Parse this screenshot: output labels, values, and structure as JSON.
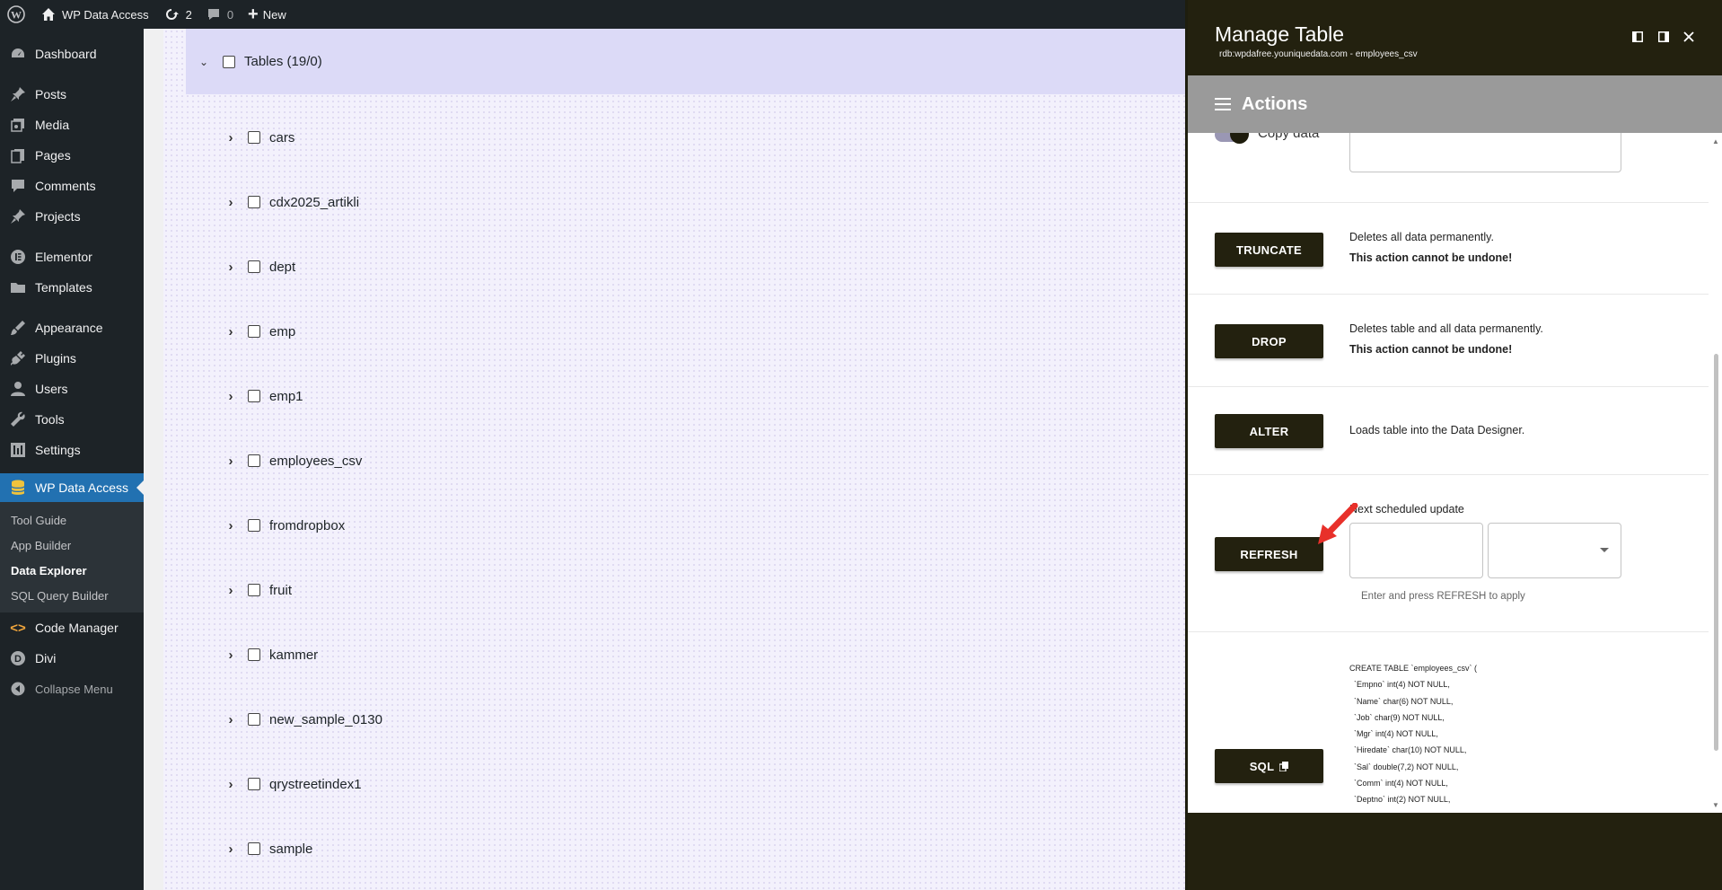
{
  "adminbar": {
    "site_name": "WP Data Access",
    "updates_count": "2",
    "comments_count": "0",
    "new_label": "New"
  },
  "sidebar": {
    "items": [
      {
        "label": "Dashboard",
        "icon": "dashboard-icon"
      },
      {
        "label": "Posts",
        "icon": "pin-icon"
      },
      {
        "label": "Media",
        "icon": "media-icon"
      },
      {
        "label": "Pages",
        "icon": "pages-icon"
      },
      {
        "label": "Comments",
        "icon": "comment-icon"
      },
      {
        "label": "Projects",
        "icon": "pin-icon"
      },
      {
        "label": "Elementor",
        "icon": "elementor-icon"
      },
      {
        "label": "Templates",
        "icon": "folder-icon"
      },
      {
        "label": "Appearance",
        "icon": "brush-icon"
      },
      {
        "label": "Plugins",
        "icon": "plug-icon"
      },
      {
        "label": "Users",
        "icon": "user-icon"
      },
      {
        "label": "Tools",
        "icon": "wrench-icon"
      },
      {
        "label": "Settings",
        "icon": "settings-icon"
      },
      {
        "label": "WP Data Access",
        "icon": "database-icon"
      },
      {
        "label": "Code Manager",
        "icon": "code-icon"
      },
      {
        "label": "Divi",
        "icon": "divi-icon"
      },
      {
        "label": "Collapse Menu",
        "icon": "collapse-icon"
      }
    ],
    "submenu": [
      "Tool Guide",
      "App Builder",
      "Data Explorer",
      "SQL Query Builder"
    ],
    "active_submenu": "Data Explorer"
  },
  "tree": {
    "header": "Tables (19/0)",
    "tables": [
      "cars",
      "cdx2025_artikli",
      "dept",
      "emp",
      "emp1",
      "employees_csv",
      "fromdropbox",
      "fruit",
      "kammer",
      "new_sample_0130",
      "qrystreetindex1",
      "sample"
    ]
  },
  "panel": {
    "title": "Manage Table",
    "subtitle": "rdb:wpdafree.youniquedata.com - employees_csv",
    "section": "Actions",
    "copy_data_label": "Copy data",
    "truncate": {
      "label": "TRUNCATE",
      "desc": "Deletes all data permanently.",
      "warn": "This action cannot be undone!"
    },
    "drop": {
      "label": "DROP",
      "desc": "Deletes table and all data permanently.",
      "warn": "This action cannot be undone!"
    },
    "alter": {
      "label": "ALTER",
      "desc": "Loads table into the Data Designer."
    },
    "refresh": {
      "label": "REFRESH",
      "schedule_label": "Next scheduled update",
      "hint": "Enter and press REFRESH to apply"
    },
    "sql": {
      "label": "SQL",
      "lines": [
        "CREATE TABLE `employees_csv` (",
        "  `Empno` int(4) NOT NULL,",
        "  `Name` char(6) NOT NULL,",
        "  `Job` char(9) NOT NULL,",
        "  `Mgr` int(4) NOT NULL,",
        "  `Hiredate` char(10) NOT NULL,",
        "  `Sal` double(7,2) NOT NULL,",
        "  `Comm` int(4) NOT NULL,",
        "  `Deptno` int(2) NOT NULL,"
      ]
    }
  },
  "colors": {
    "admin_bg": "#1d2327",
    "admin_active": "#2271b1",
    "panel_dark": "#23210f",
    "actions_bar": "#9a9a9a",
    "tree_header": "#dcdaf7",
    "arrow": "#e8302a"
  }
}
